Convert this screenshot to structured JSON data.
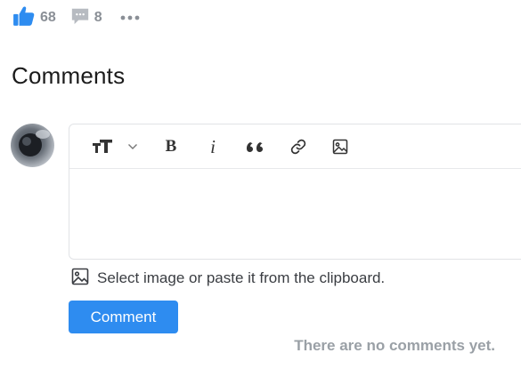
{
  "stats": {
    "likes": "68",
    "comments": "8"
  },
  "heading": "Comments",
  "toolbar": {
    "bold": "B",
    "italic": "i"
  },
  "upload_hint": "Select image or paste it from the clipboard.",
  "comment_button": "Comment",
  "empty_state": "There are no comments yet.",
  "icons": {
    "like": "thumbs-up-icon",
    "comment": "comment-bubble-icon",
    "more": "more-dots-icon",
    "text_size": "text-size-icon",
    "chevron": "chevron-down-icon",
    "quote": "quote-icon",
    "link": "link-icon",
    "image": "image-icon"
  },
  "colors": {
    "accent": "#2e8cf0",
    "muted": "#9aa0a6",
    "stat_text": "#8a8f96"
  }
}
